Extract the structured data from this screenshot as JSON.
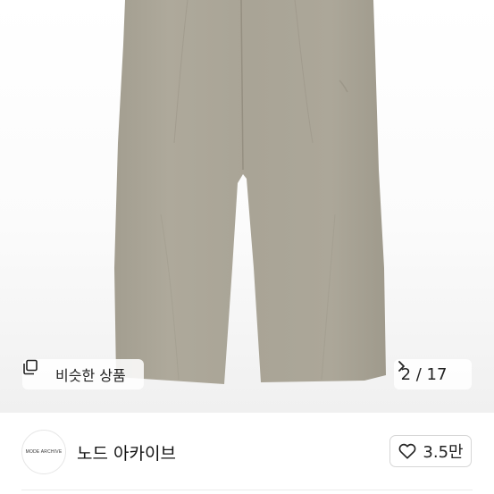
{
  "product_gallery": {
    "similar_button_label": "비슷한 상품",
    "page_counter": "2 / 17",
    "icons": {
      "similar": "stacked-squares-icon",
      "next": "chevron-right-icon"
    }
  },
  "seller": {
    "logo_text": "MODE ARCHIVE",
    "name": "노드 아카이브",
    "like_count": "3.5만",
    "like_icon": "heart-outline-icon"
  },
  "colors": {
    "pants": "#aaa597",
    "background": "#ffffff"
  }
}
